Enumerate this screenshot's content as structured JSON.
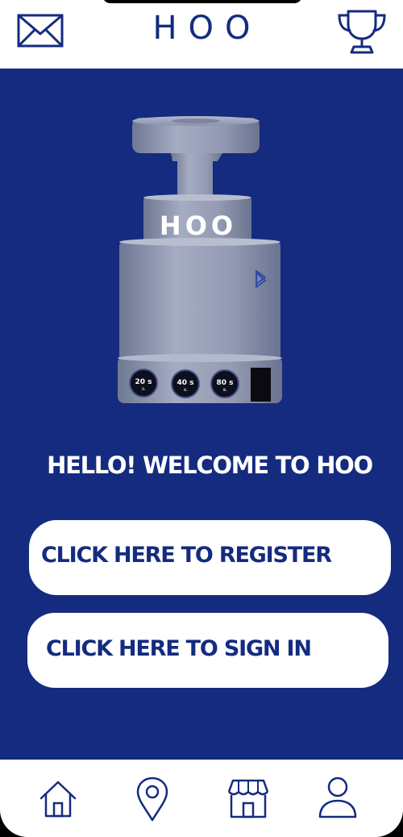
{
  "header": {
    "title": "HOO",
    "mail_icon": "mail-icon",
    "trophy_icon": "trophy-icon"
  },
  "device": {
    "brand_label": "HOO",
    "bluetooth_icon": "bluetooth-icon",
    "buttons": [
      {
        "time": "20 s",
        "volume": "2L"
      },
      {
        "time": "40 s",
        "volume": "4L"
      },
      {
        "time": "80 s",
        "volume": "8L"
      }
    ]
  },
  "main": {
    "welcome_text": "HELLO! WELCOME TO HOO",
    "register_label": "CLICK HERE TO REGISTER",
    "signin_label": "CLICK HERE TO SIGN IN"
  },
  "nav": {
    "items": [
      "home-icon",
      "location-pin-icon",
      "store-icon",
      "user-icon"
    ]
  },
  "colors": {
    "primary": "#142b80",
    "surface": "#ffffff",
    "device_body": "#8d95ae"
  }
}
